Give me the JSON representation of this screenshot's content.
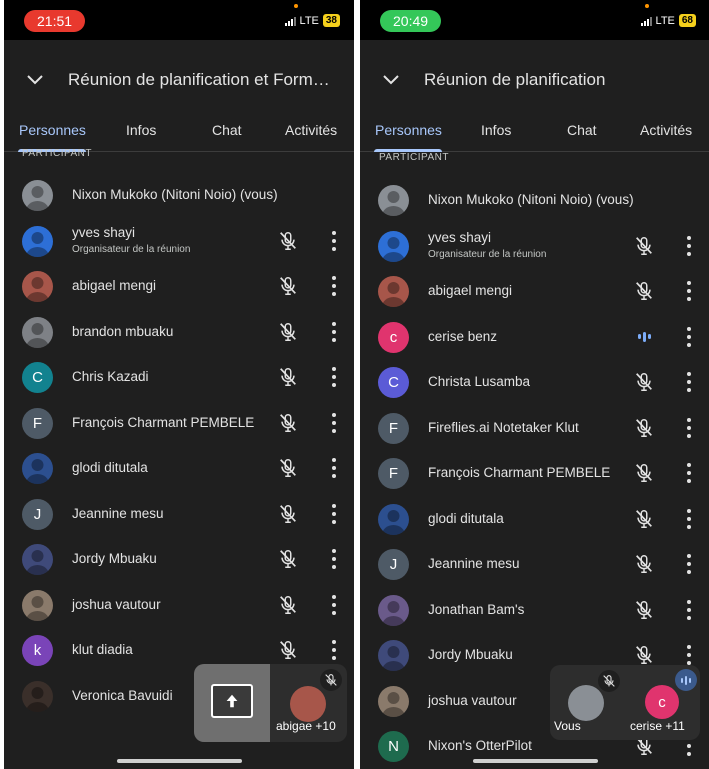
{
  "colors": {
    "accent": "#a8c7fa",
    "background": "#1f1f1f",
    "active_speaker": "#7cacf8"
  },
  "left": {
    "status": {
      "time": "21:51",
      "time_color": "#e8392e",
      "network": "LTE",
      "battery": "38",
      "battery_color": "#f5d01c"
    },
    "header": {
      "title": "Réunion de planification et Formati..."
    },
    "tabs": [
      "Personnes",
      "Infos",
      "Chat",
      "Activités"
    ],
    "section_label": "PARTICIPANT",
    "participants": [
      {
        "name": "Nixon Mukoko (Nitoni Noio) (vous)",
        "avatar": "photo",
        "color": "#8a8f95",
        "controls": false
      },
      {
        "name": "yves shayi",
        "subtitle": "Organisateur de la réunion",
        "avatar": "photo",
        "color": "#2d6fd6",
        "controls": true
      },
      {
        "name": "abigael mengi",
        "avatar": "photo",
        "color": "#a7564a",
        "controls": true
      },
      {
        "name": "brandon mbuaku",
        "avatar": "photo",
        "color": "#7e8186",
        "controls": true
      },
      {
        "name": "Chris Kazadi",
        "initial": "C",
        "color": "#12828f",
        "controls": true
      },
      {
        "name": "François Charmant PEMBELE",
        "initial": "F",
        "color": "#4e5a66",
        "controls": true
      },
      {
        "name": "glodi ditutala",
        "avatar": "photo",
        "color": "#2c4f8f",
        "controls": true
      },
      {
        "name": "Jeannine mesu",
        "initial": "J",
        "color": "#4e5a66",
        "controls": true
      },
      {
        "name": "Jordy Mbuaku",
        "avatar": "photo",
        "color": "#3f4a7a",
        "controls": true
      },
      {
        "name": "joshua vautour",
        "avatar": "photo",
        "color": "#8a7a6b",
        "controls": true
      },
      {
        "name": "klut diadia",
        "initial": "k",
        "color": "#7a44b8",
        "controls": true
      },
      {
        "name": "Veronica Bavuidi",
        "avatar": "photo",
        "color": "#3a2f2a",
        "controls": false
      }
    ],
    "floating": {
      "name": "abigae",
      "count": "+10"
    }
  },
  "right": {
    "status": {
      "time": "20:49",
      "time_color": "#34c759",
      "network": "LTE",
      "battery": "68",
      "battery_color": "#f5d01c"
    },
    "header": {
      "title": "Réunion de planification"
    },
    "tabs": [
      "Personnes",
      "Infos",
      "Chat",
      "Activités"
    ],
    "section_label": "PARTICIPANT",
    "participants": [
      {
        "name": "Nixon Mukoko (Nitoni Noio) (vous)",
        "avatar": "photo",
        "color": "#8a8f95",
        "controls": false
      },
      {
        "name": "yves shayi",
        "subtitle": "Organisateur de la réunion",
        "avatar": "photo",
        "color": "#2d6fd6",
        "controls": true
      },
      {
        "name": "abigael mengi",
        "avatar": "photo",
        "color": "#a7564a",
        "controls": true
      },
      {
        "name": "cerise benz",
        "initial": "c",
        "color": "#e0346e",
        "controls": true,
        "speaking": true
      },
      {
        "name": "Christa Lusamba",
        "initial": "C",
        "color": "#5b5bd6",
        "controls": true
      },
      {
        "name": "Fireflies.ai Notetaker Klut",
        "initial": "F",
        "color": "#4e5a66",
        "controls": true
      },
      {
        "name": "François Charmant PEMBELE",
        "initial": "F",
        "color": "#4e5a66",
        "controls": true
      },
      {
        "name": "glodi ditutala",
        "avatar": "photo",
        "color": "#2c4f8f",
        "controls": true
      },
      {
        "name": "Jeannine mesu",
        "initial": "J",
        "color": "#4e5a66",
        "controls": true
      },
      {
        "name": "Jonathan Bam's",
        "avatar": "photo",
        "color": "#6a5a8a",
        "controls": true
      },
      {
        "name": "Jordy Mbuaku",
        "avatar": "photo",
        "color": "#3f4a7a",
        "controls": true
      },
      {
        "name": "joshua vautour",
        "avatar": "photo",
        "color": "#8a7a6b",
        "controls": false
      },
      {
        "name": "Nixon's OtterPilot",
        "initial": "N",
        "color": "#1e6b4e",
        "controls": true
      }
    ],
    "floating": {
      "self_label": "Vous",
      "name": "cerise",
      "initial": "c",
      "count": "+11"
    }
  }
}
